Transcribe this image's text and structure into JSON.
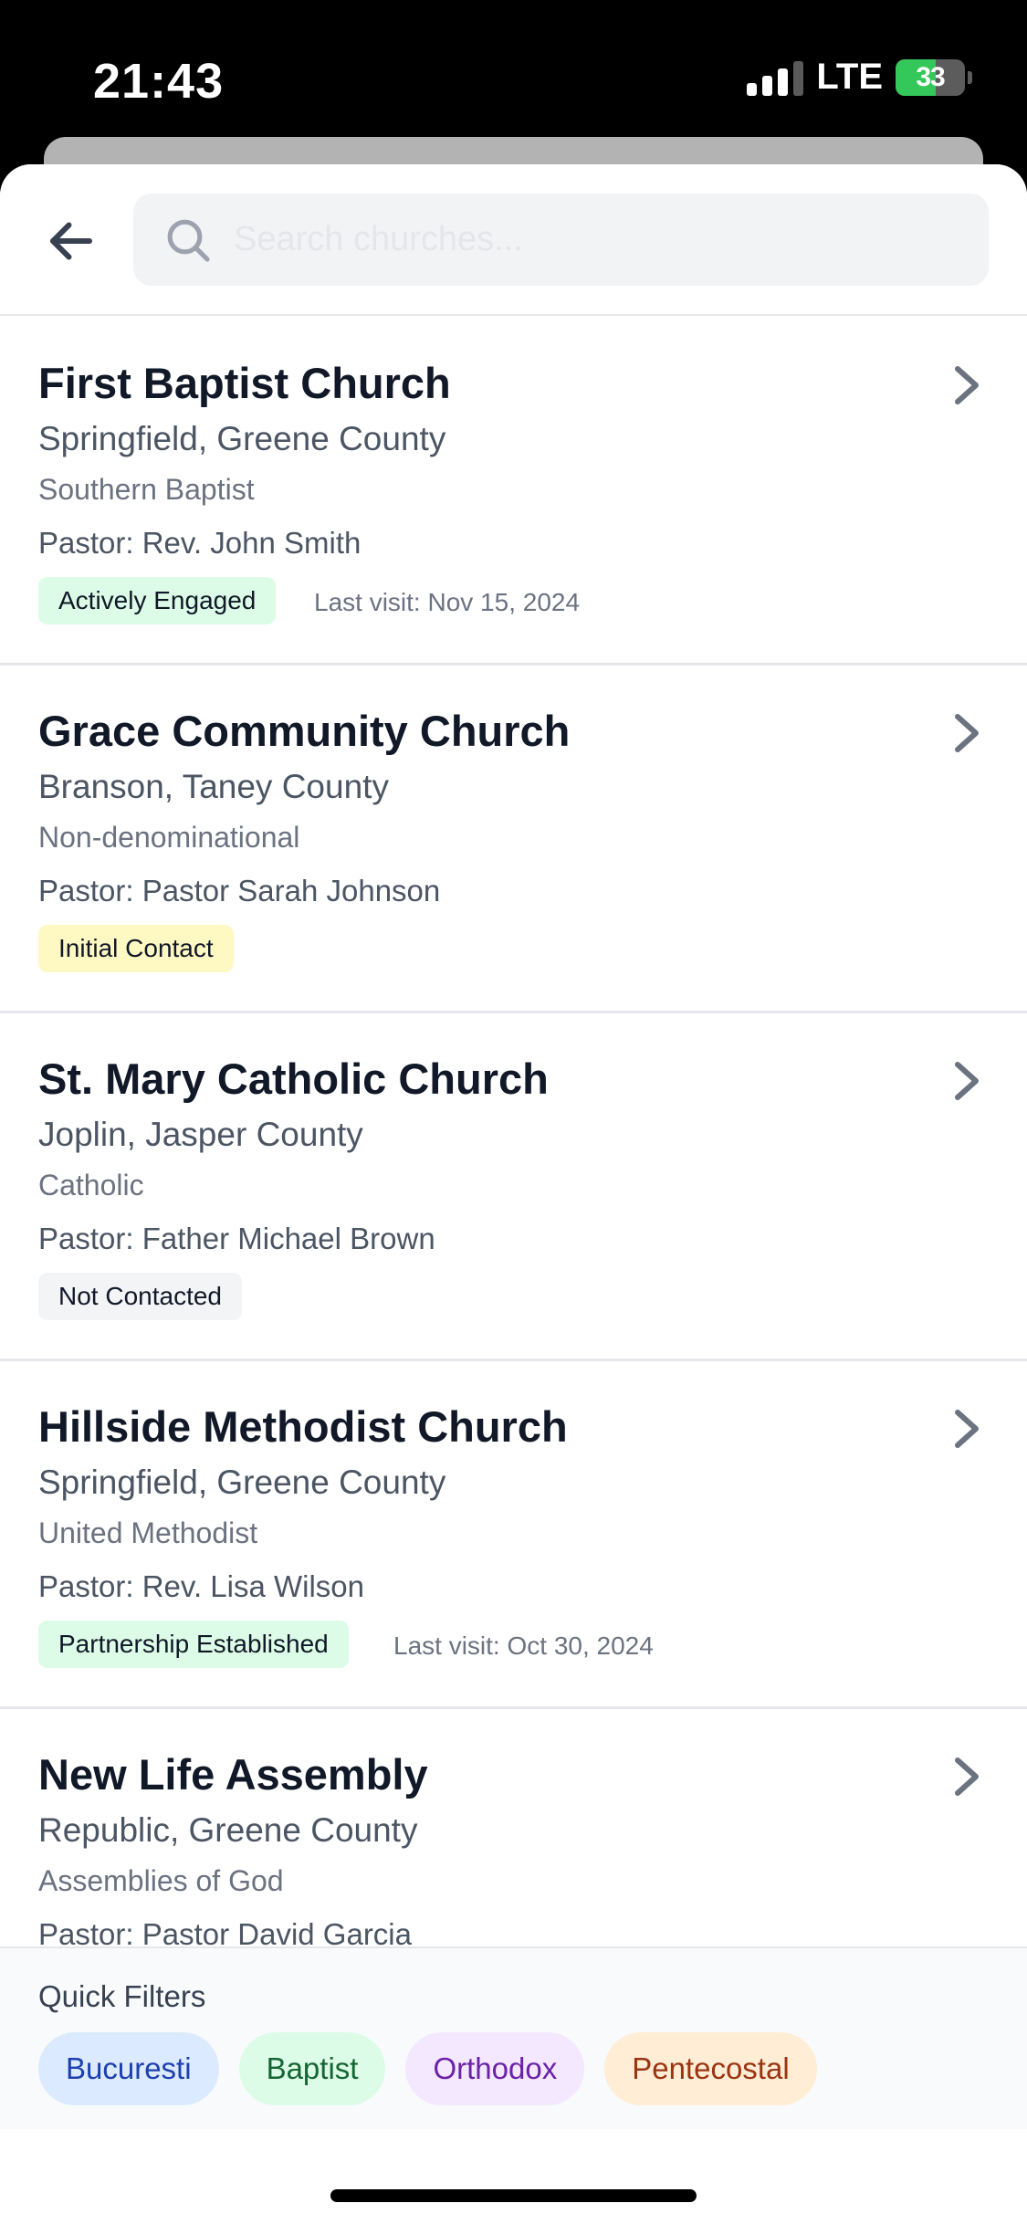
{
  "status_bar": {
    "time": "21:43",
    "network": "LTE",
    "battery": "33"
  },
  "search": {
    "placeholder": "Search churches..."
  },
  "churches": [
    {
      "name": "First Baptist Church",
      "location": "Springfield, Greene County",
      "denomination": "Southern Baptist",
      "pastor": "Pastor: Rev. John Smith",
      "status": "Actively Engaged",
      "status_bg": "#dcfce7",
      "last_visit": "Last visit: Nov 15, 2024"
    },
    {
      "name": "Grace Community Church",
      "location": "Branson, Taney County",
      "denomination": "Non-denominational",
      "pastor": "Pastor: Pastor Sarah Johnson",
      "status": "Initial Contact",
      "status_bg": "#fef9c3",
      "last_visit": ""
    },
    {
      "name": "St. Mary Catholic Church",
      "location": "Joplin, Jasper County",
      "denomination": "Catholic",
      "pastor": "Pastor: Father Michael Brown",
      "status": "Not Contacted",
      "status_bg": "#f3f4f6",
      "last_visit": ""
    },
    {
      "name": "Hillside Methodist Church",
      "location": "Springfield, Greene County",
      "denomination": "United Methodist",
      "pastor": "Pastor: Rev. Lisa Wilson",
      "status": "Partnership Established",
      "status_bg": "#dcfce7",
      "last_visit": "Last visit: Oct 30, 2024"
    },
    {
      "name": "New Life Assembly",
      "location": "Republic, Greene County",
      "denomination": "Assemblies of God",
      "pastor": "Pastor: Pastor David Garcia",
      "status": "",
      "status_bg": "",
      "last_visit": ""
    }
  ],
  "quick_filters": {
    "title": "Quick Filters",
    "chips": [
      {
        "label": "Bucuresti",
        "bg": "#dbeafe",
        "color": "#1e40af"
      },
      {
        "label": "Baptist",
        "bg": "#dcfce7",
        "color": "#166534"
      },
      {
        "label": "Orthodox",
        "bg": "#f3e8ff",
        "color": "#6b21a8"
      },
      {
        "label": "Pentecostal",
        "bg": "#ffedd5",
        "color": "#9a3412"
      }
    ]
  },
  "icons": {
    "back": "arrow-left-icon",
    "search": "search-icon",
    "chevron": "chevron-right-icon"
  }
}
